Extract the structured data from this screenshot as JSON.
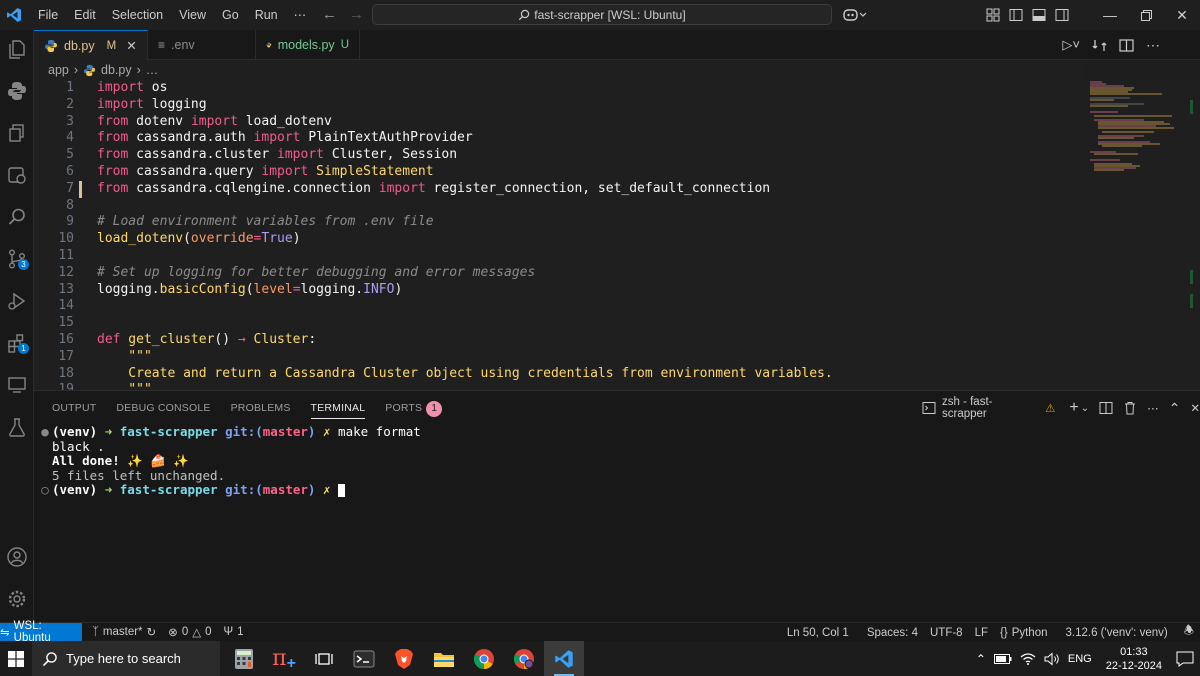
{
  "menu": [
    "File",
    "Edit",
    "Selection",
    "View",
    "Go",
    "Run",
    "⋯"
  ],
  "command_center": "fast-scrapper [WSL: Ubuntu]",
  "tabs": [
    {
      "label": "db.py",
      "flag": "M",
      "active": true,
      "icon": "python-icon"
    },
    {
      "label": ".env",
      "flag": "",
      "active": false,
      "icon": "env-icon"
    },
    {
      "label": "models.py",
      "flag": "U",
      "active": false,
      "icon": "python-icon"
    }
  ],
  "breadcrumb": {
    "root": "app",
    "file": "db.py",
    "more": "…"
  },
  "activity_badges": {
    "source_control": "3",
    "extensions": "1"
  },
  "code_lines": [
    {
      "n": "1",
      "tokens": [
        [
          "kw",
          "import"
        ],
        [
          "mod",
          " os"
        ]
      ]
    },
    {
      "n": "2",
      "tokens": [
        [
          "kw",
          "import"
        ],
        [
          "mod",
          " logging"
        ]
      ]
    },
    {
      "n": "3",
      "tokens": [
        [
          "kw",
          "from"
        ],
        [
          "mod",
          " dotenv "
        ],
        [
          "kw",
          "import"
        ],
        [
          "mod",
          " load_dotenv"
        ]
      ]
    },
    {
      "n": "4",
      "tokens": [
        [
          "kw",
          "from"
        ],
        [
          "mod",
          " cassandra.auth "
        ],
        [
          "kw",
          "import"
        ],
        [
          "mod",
          " PlainTextAuthProvider"
        ]
      ]
    },
    {
      "n": "5",
      "tokens": [
        [
          "kw",
          "from"
        ],
        [
          "mod",
          " cassandra.cluster "
        ],
        [
          "kw",
          "import"
        ],
        [
          "mod",
          " Cluster, Session"
        ]
      ]
    },
    {
      "n": "6",
      "tokens": [
        [
          "kw",
          "from"
        ],
        [
          "mod",
          " cassandra.query "
        ],
        [
          "kw",
          "import"
        ],
        [
          "id",
          " SimpleStatement"
        ]
      ]
    },
    {
      "n": "7",
      "tokens": [
        [
          "kw",
          "from"
        ],
        [
          "mod",
          " cassandra.cqlengine.connection "
        ],
        [
          "kw",
          "import"
        ],
        [
          "mod",
          " register_connection, set_default_connection"
        ]
      ]
    },
    {
      "n": "8",
      "tokens": []
    },
    {
      "n": "9",
      "tokens": [
        [
          "cm",
          "# Load environment variables from .env file"
        ]
      ]
    },
    {
      "n": "10",
      "tokens": [
        [
          "fn",
          "load_dotenv"
        ],
        [
          "mod",
          "("
        ],
        [
          "param",
          "override"
        ],
        [
          "op",
          "="
        ],
        [
          "const",
          "True"
        ],
        [
          "mod",
          ")"
        ]
      ]
    },
    {
      "n": "11",
      "tokens": []
    },
    {
      "n": "12",
      "tokens": [
        [
          "cm",
          "# Set up logging for better debugging and error messages"
        ]
      ]
    },
    {
      "n": "13",
      "tokens": [
        [
          "mod",
          "logging."
        ],
        [
          "fn",
          "basicConfig"
        ],
        [
          "mod",
          "("
        ],
        [
          "param",
          "level"
        ],
        [
          "op",
          "="
        ],
        [
          "mod",
          "logging."
        ],
        [
          "const",
          "INFO"
        ],
        [
          "mod",
          ")"
        ]
      ]
    },
    {
      "n": "14",
      "tokens": []
    },
    {
      "n": "15",
      "tokens": []
    },
    {
      "n": "16",
      "tokens": [
        [
          "kw",
          "def"
        ],
        [
          "fn",
          " get_cluster"
        ],
        [
          "mod",
          "() "
        ],
        [
          "op",
          "→"
        ],
        [
          "cls",
          " Cluster"
        ],
        [
          "mod",
          ":"
        ]
      ]
    },
    {
      "n": "17",
      "tokens": [
        [
          "str",
          "    \"\"\""
        ]
      ]
    },
    {
      "n": "18",
      "tokens": [
        [
          "str",
          "    Create and return a Cassandra Cluster object using credentials from environment variables."
        ]
      ]
    },
    {
      "n": "19",
      "tokens": [
        [
          "str",
          "    \"\"\""
        ]
      ]
    }
  ],
  "panel_tabs": [
    "OUTPUT",
    "DEBUG CONSOLE",
    "PROBLEMS",
    "TERMINAL",
    "PORTS"
  ],
  "ports_count": "1",
  "terminal_name": "zsh - fast-scrapper",
  "terminal": {
    "line1": {
      "venv": "(venv)",
      "arrow": "➜",
      "dir": "fast-scrapper",
      "git": "git:(",
      "branch": "master",
      "gitclose": ")",
      "x": "✗",
      "cmd": "make format"
    },
    "line2": "black .",
    "line3": "All done! ✨ 🍰 ✨",
    "line4": "5 files left unchanged.",
    "line5": {
      "venv": "(venv)",
      "arrow": "➜",
      "dir": "fast-scrapper",
      "git": "git:(",
      "branch": "master",
      "gitclose": ")",
      "x": "✗"
    }
  },
  "status": {
    "remote": "WSL: Ubuntu",
    "branch": "master*",
    "errors": "0",
    "warnings": "0",
    "ports": "1",
    "position": "Ln 50, Col 1",
    "spaces": "Spaces: 4",
    "encoding": "UTF-8",
    "eol": "LF",
    "language": "Python",
    "interpreter": "3.12.6 ('venv': venv)"
  },
  "taskbar": {
    "search_placeholder": "Type here to search",
    "lang": "ENG",
    "time": "01:33",
    "date": "22-12-2024"
  }
}
